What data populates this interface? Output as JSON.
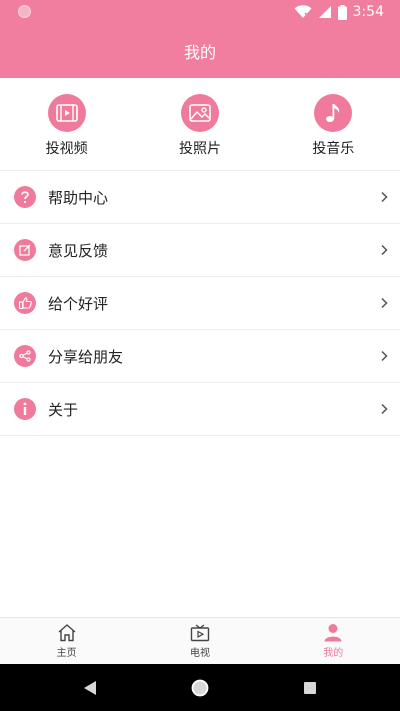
{
  "status": {
    "time": "3:54"
  },
  "header": {
    "title": "我的"
  },
  "actions": [
    {
      "label": "投视频",
      "icon": "video-icon"
    },
    {
      "label": "投照片",
      "icon": "photo-icon"
    },
    {
      "label": "投音乐",
      "icon": "music-icon"
    }
  ],
  "menu": [
    {
      "label": "帮助中心",
      "icon": "help-icon"
    },
    {
      "label": "意见反馈",
      "icon": "edit-icon"
    },
    {
      "label": "给个好评",
      "icon": "thumbs-up-icon"
    },
    {
      "label": "分享给朋友",
      "icon": "share-icon"
    },
    {
      "label": "关于",
      "icon": "info-icon"
    }
  ],
  "bottom_nav": [
    {
      "label": "主页",
      "icon": "home-icon"
    },
    {
      "label": "电视",
      "icon": "tv-icon"
    },
    {
      "label": "我的",
      "icon": "user-icon",
      "active": true
    }
  ],
  "colors": {
    "accent": "#ef7a9c",
    "header": "#f17d9f"
  }
}
